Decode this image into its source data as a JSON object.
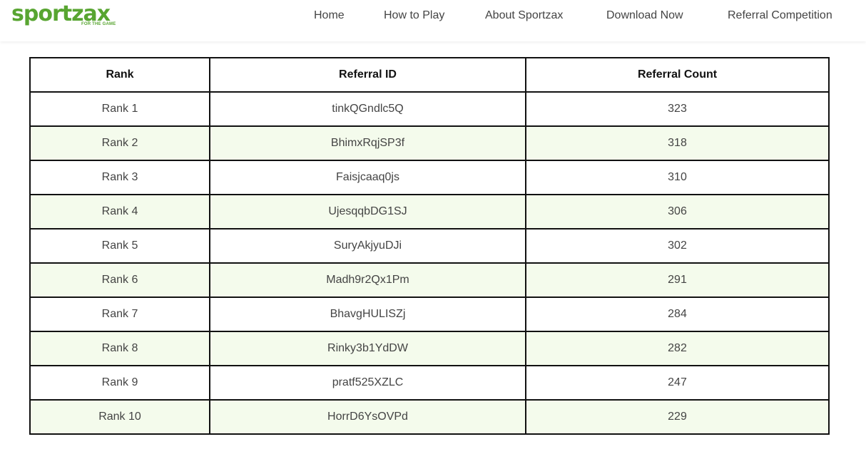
{
  "logo": {
    "wordmark": "sportzax",
    "tagline": "FOR THE GAME"
  },
  "nav": {
    "items": [
      "Home",
      "How to Play",
      "About Sportzax",
      "Download Now",
      "Referral Competition"
    ]
  },
  "table": {
    "headers": [
      "Rank",
      "Referral ID",
      "Referral Count"
    ],
    "rows": [
      [
        "Rank 1",
        "tinkQGndlc5Q",
        "323"
      ],
      [
        "Rank 2",
        "BhimxRqjSP3f",
        "318"
      ],
      [
        "Rank 3",
        "Faisjcaaq0js",
        "310"
      ],
      [
        "Rank 4",
        "UjesqqbDG1SJ",
        "306"
      ],
      [
        "Rank 5",
        "SuryAkjyuDJi",
        "302"
      ],
      [
        "Rank 6",
        "Madh9r2Qx1Pm",
        "291"
      ],
      [
        "Rank 7",
        "BhavgHULISZj",
        "284"
      ],
      [
        "Rank 8",
        "Rinky3b1YdDW",
        "282"
      ],
      [
        "Rank 9",
        "pratf525XZLC",
        "247"
      ],
      [
        "Rank 10",
        "HorrD6YsOVPd",
        "229"
      ]
    ]
  },
  "colors": {
    "brand": "#58a531",
    "row_alt": "#f4fbec",
    "border": "#111111"
  }
}
